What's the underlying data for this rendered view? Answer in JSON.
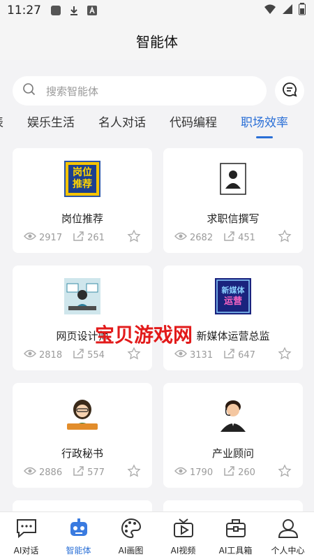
{
  "status_bar": {
    "time": "11:27"
  },
  "header": {
    "title": "智能体"
  },
  "search": {
    "placeholder": "搜索智能体"
  },
  "tabs": [
    "图表",
    "娱乐生活",
    "名人对话",
    "代码编程",
    "职场效率"
  ],
  "tab_partial_visible": "表",
  "active_tab_index": 4,
  "cards": [
    {
      "name": "岗位推荐",
      "views": "2917",
      "shares": "261",
      "thumb_text_1": "岗位",
      "thumb_text_2": "推荐"
    },
    {
      "name": "求职信撰写",
      "views": "2682",
      "shares": "451"
    },
    {
      "name": "网页设计师",
      "views": "2818",
      "shares": "554"
    },
    {
      "name": "新媒体运营总监",
      "views": "3131",
      "shares": "647",
      "thumb_text_1": "新媒体",
      "thumb_text_2": "运营"
    },
    {
      "name": "行政秘书",
      "views": "2886",
      "shares": "577"
    },
    {
      "name": "产业顾问",
      "views": "1790",
      "shares": "260"
    }
  ],
  "watermark": "宝贝游戏网",
  "bottom_nav": [
    {
      "label": "AI对话",
      "icon": "chat-bubble-icon"
    },
    {
      "label": "智能体",
      "icon": "robot-icon"
    },
    {
      "label": "AI画图",
      "icon": "palette-icon"
    },
    {
      "label": "AI视频",
      "icon": "tv-play-icon"
    },
    {
      "label": "AI工具箱",
      "icon": "toolbox-icon"
    },
    {
      "label": "个人中心",
      "icon": "person-icon"
    }
  ],
  "active_nav_index": 1,
  "colors": {
    "accent": "#2a6fd6",
    "watermark": "#e21a1a",
    "background": "#f3f3f5"
  }
}
